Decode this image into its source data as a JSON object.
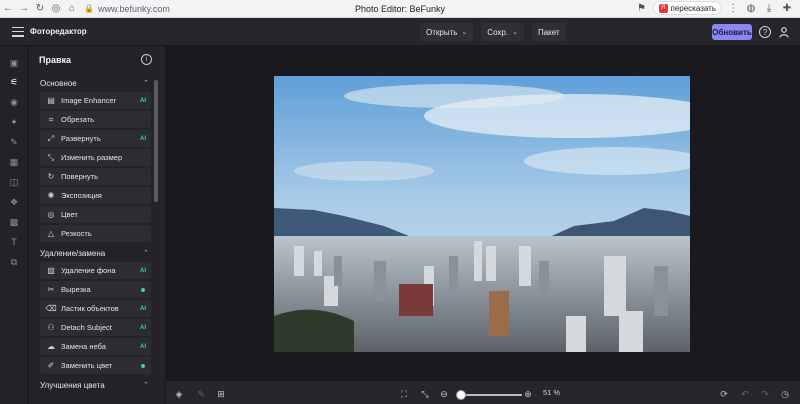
{
  "browser": {
    "url": "www.befunky.com",
    "tab_title": "Photo Editor: BeFunky",
    "translate_label": "пересказать"
  },
  "topbar": {
    "app_title": "Фоторедактор",
    "open_label": "Открыть",
    "save_label": "Сохр.",
    "batch_label": "Пакет",
    "upgrade_label": "Обновить"
  },
  "panel": {
    "title": "Правка",
    "sections": {
      "basic": "Основное",
      "removal": "Удаление/замена",
      "color": "Улучшения цвета"
    },
    "basic_tools": [
      {
        "label": "Image Enhancer",
        "badge": "AI"
      },
      {
        "label": "Обрезать",
        "badge": ""
      },
      {
        "label": "Развернуть",
        "badge": "AI"
      },
      {
        "label": "Изменить размер",
        "badge": ""
      },
      {
        "label": "Повернуть",
        "badge": ""
      },
      {
        "label": "Экспозиция",
        "badge": ""
      },
      {
        "label": "Цвет",
        "badge": ""
      },
      {
        "label": "Резкость",
        "badge": ""
      }
    ],
    "removal_tools": [
      {
        "label": "Удаление фона",
        "badge": "AI"
      },
      {
        "label": "Вырезка",
        "badge": ""
      },
      {
        "label": "Ластик объектов",
        "badge": "AI"
      },
      {
        "label": "Detach Subject",
        "badge": "AI"
      },
      {
        "label": "Замена неба",
        "badge": "AI"
      },
      {
        "label": "Заменить цвет",
        "badge": ""
      }
    ]
  },
  "bottombar": {
    "zoom_label": "51 %",
    "zoom_level": 51
  },
  "colors": {
    "accent": "#8a87f5",
    "ai_badge": "#3ad0a6",
    "background": "#1b1b1f"
  }
}
